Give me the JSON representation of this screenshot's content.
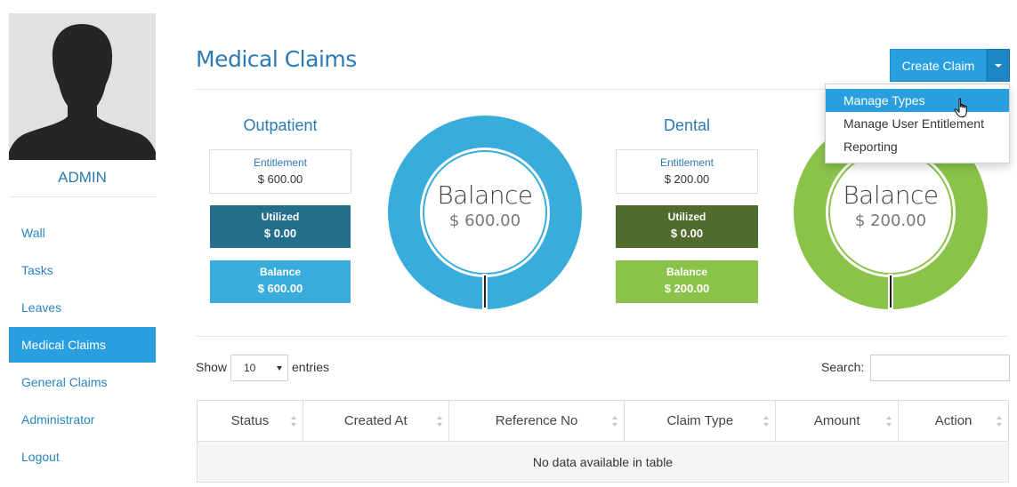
{
  "sidebar": {
    "username": "ADMIN",
    "nav": [
      {
        "label": "Wall",
        "active": false
      },
      {
        "label": "Tasks",
        "active": false
      },
      {
        "label": "Leaves",
        "active": false
      },
      {
        "label": "Medical Claims",
        "active": true
      },
      {
        "label": "General Claims",
        "active": false
      },
      {
        "label": "Administrator",
        "active": false
      },
      {
        "label": "Logout",
        "active": false
      }
    ]
  },
  "header": {
    "title": "Medical Claims",
    "create_button": "Create Claim",
    "dropdown": [
      "Manage Types",
      "Manage User Entitlement",
      "Reporting"
    ]
  },
  "claims": [
    {
      "name": "Outpatient",
      "entitlement_label": "Entitlement",
      "entitlement_value": "$ 600.00",
      "utilized_label": "Utilized",
      "utilized_value": "$ 0.00",
      "balance_label": "Balance",
      "balance_value": "$ 600.00",
      "donut_label": "Balance",
      "donut_value": "$ 600.00",
      "colors": {
        "title": "#2a7ab0",
        "utilized": "#236e8b",
        "balance": "#3aacdc",
        "ring": "#3aacdc"
      }
    },
    {
      "name": "Dental",
      "entitlement_label": "Entitlement",
      "entitlement_value": "$ 200.00",
      "utilized_label": "Utilized",
      "utilized_value": "$ 0.00",
      "balance_label": "Balance",
      "balance_value": "$ 200.00",
      "donut_label": "Balance",
      "donut_value": "$ 200.00",
      "colors": {
        "title": "#2a7ab0",
        "utilized": "#4f6b2e",
        "balance": "#8bc34a",
        "ring": "#8bc34a"
      }
    }
  ],
  "table": {
    "show_label": "Show",
    "length_value": "10",
    "entries_label": "entries",
    "search_label": "Search:",
    "columns": [
      "Status",
      "Created At",
      "Reference No",
      "Claim Type",
      "Amount",
      "Action"
    ],
    "empty_text": "No data available in table"
  },
  "icons": {
    "avatar": "user-silhouette-icon",
    "cursor": "hand-pointer-icon",
    "sort": "sort-both-icon",
    "caret": "caret-down-icon"
  }
}
